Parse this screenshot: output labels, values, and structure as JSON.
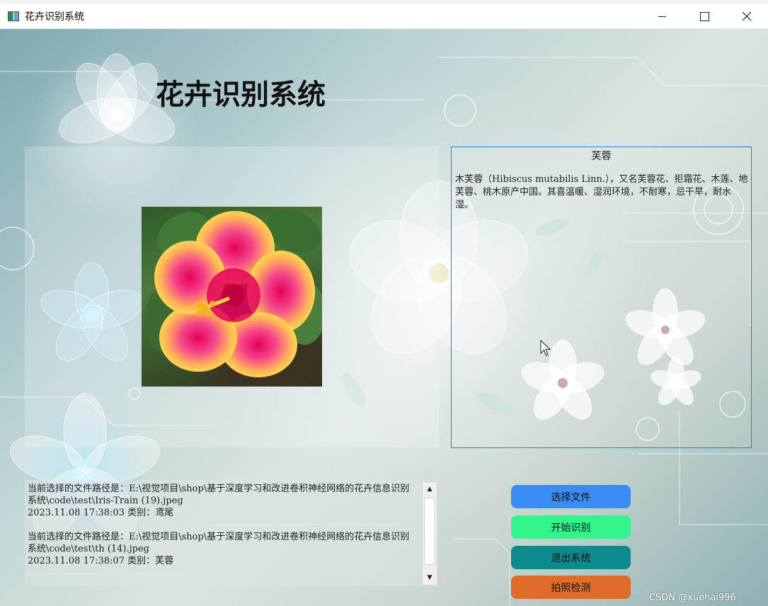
{
  "window": {
    "title": "花卉识别系统"
  },
  "app": {
    "title": "花卉识别系统"
  },
  "result": {
    "name": "芙蓉",
    "description": "木芙蓉（Hibiscus mutabilis Linn.），又名芙蓉花、拒霜花、木莲、地芙蓉、桃木原产中国。其喜温暖、湿润环境，不耐寒，忌干旱，耐水湿。"
  },
  "log": {
    "entries": [
      {
        "path": "当前选择的文件路径是：E:\\视觉项目\\shop\\基于深度学习和改进卷积神经网络的花卉信息识别系统\\code\\test\\Iris-Train (19).jpeg",
        "result": "2023.11.08 17:38:03 类别：鸢尾"
      },
      {
        "path": "当前选择的文件路径是：E:\\视觉项目\\shop\\基于深度学习和改进卷积神经网络的花卉信息识别系统\\code\\test\\th (14).jpeg",
        "result": "2023.11.08 17:38:07 类别：芙蓉"
      }
    ]
  },
  "buttons": {
    "select_file": "选择文件",
    "start_recognition": "开始识别",
    "exit_system": "退出系统",
    "photo_detect": "拍照检测"
  },
  "colors": {
    "select_file": "#3b8cf5",
    "start_recognition": "#33f58c",
    "exit_system": "#0d8a8e",
    "photo_detect": "#e06c2c",
    "result_border": "#2f7fd0"
  },
  "watermark": "CSDN @xuehai996",
  "icons": {
    "app": "app-window-icon",
    "minimize": "minimize-icon",
    "maximize": "maximize-icon",
    "close": "close-icon",
    "scroll_up": "scroll-up-arrow-icon",
    "scroll_down": "scroll-down-arrow-icon",
    "cursor": "mouse-cursor-icon"
  }
}
